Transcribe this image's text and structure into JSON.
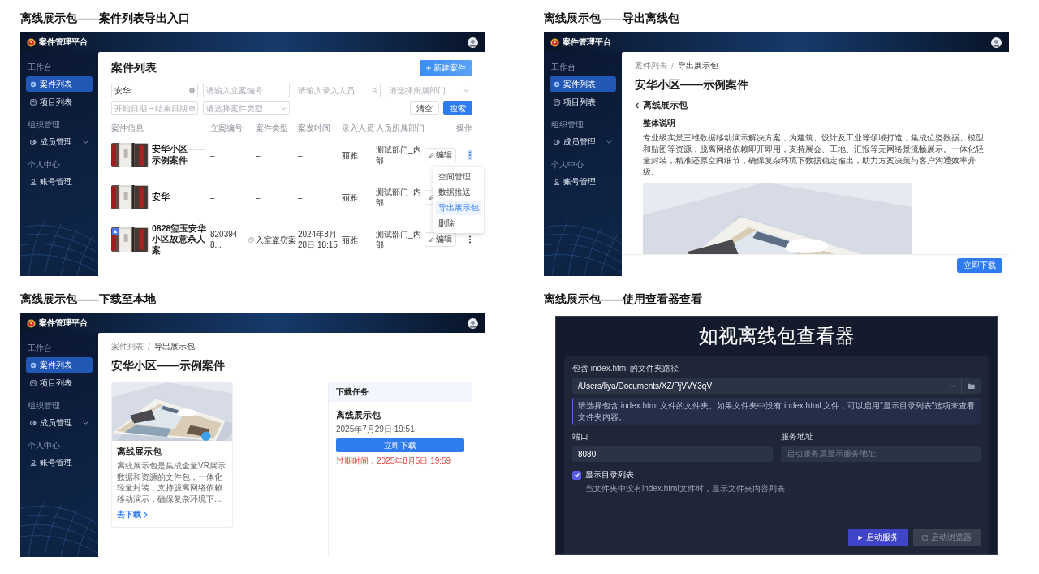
{
  "sections": [
    {
      "heading": "离线展示包——案件列表导出入口",
      "kind": "case_list",
      "app": {
        "brand": "案件管理平台",
        "nav": [
          {
            "group": "工作台",
            "items": [
              {
                "label": "案件列表",
                "selected": true
              },
              {
                "label": "项目列表",
                "selected": false
              }
            ]
          },
          {
            "group": "组织管理",
            "items": [
              {
                "label": "成员管理",
                "selected": false,
                "expanded": false
              }
            ]
          },
          {
            "group": "个人中心",
            "items": [
              {
                "label": "账号管理",
                "selected": false
              }
            ]
          }
        ]
      },
      "title": "案件列表",
      "new_button": "新建案件",
      "filters": [
        {
          "kind": "clearable",
          "value": "安华"
        },
        {
          "kind": "text",
          "placeholder": "请输入立案编号"
        },
        {
          "kind": "search",
          "placeholder": "请输入录入人员"
        },
        {
          "kind": "select",
          "placeholder": "请选择所属部门"
        },
        {
          "kind": "daterange",
          "start_placeholder": "开始日期",
          "end_placeholder": "结束日期"
        },
        {
          "kind": "select",
          "placeholder": "请选择案件类型"
        }
      ],
      "filter_buttons": [
        {
          "label": "清空",
          "kind": "secondary"
        },
        {
          "label": "搜索",
          "kind": "primary"
        }
      ],
      "columns": [
        "案件信息",
        "立案编号",
        "案件类型",
        "案发时间",
        "录入人员",
        "人员所属部门",
        "操作"
      ],
      "rows": [
        {
          "name": "安华小区——示例案件",
          "badge": false,
          "number": "–",
          "copyable": false,
          "type": "–",
          "time": "–",
          "person": "丽雅",
          "department": "测试部门_内部",
          "action": "编辑",
          "menu_open": true
        },
        {
          "name": "安华",
          "badge": false,
          "number": "–",
          "copyable": false,
          "type": "–",
          "time": "–",
          "person": "丽雅",
          "department": "测试部门_内部",
          "menu_open": false
        },
        {
          "name": "0828玺玉安华小区故意杀人案",
          "badge": true,
          "number": "8203948...",
          "copyable": true,
          "type": "入室盗窃案",
          "time": "2024年8月28日 18:15",
          "person": "丽雅",
          "department": "测试部门_内部",
          "action": "编辑",
          "menu_open": false
        }
      ],
      "menu": [
        {
          "label": "空间管理",
          "selected": false
        },
        {
          "label": "数据推送",
          "selected": false
        },
        {
          "label": "导出展示包",
          "selected": true
        },
        {
          "label": "删除",
          "selected": false
        }
      ]
    },
    {
      "heading": "离线展示包——导出离线包",
      "kind": "export",
      "app": {
        "brand": "案件管理平台",
        "nav": [
          {
            "group": "工作台",
            "items": [
              {
                "label": "案件列表",
                "selected": true
              },
              {
                "label": "项目列表",
                "selected": false
              }
            ]
          },
          {
            "group": "组织管理",
            "items": [
              {
                "label": "成员管理",
                "selected": false,
                "expanded": false
              }
            ]
          },
          {
            "group": "个人中心",
            "items": [
              {
                "label": "账号管理",
                "selected": false
              }
            ]
          }
        ]
      },
      "breadcrumb": [
        "案件列表",
        "导出展示包"
      ],
      "breadcrumb_separator": "/",
      "title": "安华小区——示例案件",
      "back": "离线展示包",
      "section_title": "整体说明",
      "description": "专业级实景三维数据移动演示解决方案，为建筑、设计及工业等领域打造，集成位姿数据、模型和贴图等资源，脱离网络依赖即开即用，支持展会、工地、汇报等无网络景流畅展示。一体化轻量封装，精准还原空间细节，确保复杂环境下数据稳定输出，助力方案决策与客户沟通效率升级。",
      "picture": {
        "kind": "picture"
      },
      "download_button": "立即下载"
    },
    {
      "heading": "离线展示包——下载至本地",
      "kind": "download",
      "app": {
        "brand": "案件管理平台",
        "nav": [
          {
            "group": "工作台",
            "items": [
              {
                "label": "案件列表",
                "selected": true
              },
              {
                "label": "项目列表",
                "selected": false
              }
            ]
          },
          {
            "group": "组织管理",
            "items": [
              {
                "label": "成员管理",
                "selected": false,
                "expanded": false
              }
            ]
          },
          {
            "group": "个人中心",
            "items": [
              {
                "label": "账号管理",
                "selected": false
              }
            ]
          }
        ]
      },
      "breadcrumb": [
        "案件列表",
        "导出展示包"
      ],
      "breadcrumb_separator": "/",
      "title": "安华小区——示例案件",
      "card": {
        "title": "离线展示包",
        "description": "离线展示包是集成全量VR展示数据和资源的文件包，一体化轻量封装，支持脱离网络依赖移动演示，确保复杂环境下...",
        "link": "去下载"
      },
      "tasks": {
        "title": "下载任务",
        "items": [
          {
            "name": "离线展示包",
            "date": "2025年7月29日 19:51",
            "button": "立即下载",
            "expiry": "过期时间：2025年8月5日 19:59"
          }
        ]
      }
    },
    {
      "heading": "离线展示包——使用查看器查看",
      "kind": "viewer",
      "title": "如视离线包查看器",
      "path_label": "包含 index.html 的文件夹路径",
      "path_value": "/Users/liya/Documents/XZ/PjVVY3qV",
      "hint": "请选择包含 index.html 文件的文件夹。如果文件夹中没有 index.html 文件，可以启用\"显示目录列表\"选项来查看文件夹内容。",
      "port_label": "端口",
      "port_value": "8080",
      "address_label": "服务地址",
      "address_placeholder": "启动服务后显示服务地址",
      "show_listing": {
        "label": "显示目录列表",
        "checked": true,
        "help": "当文件夹中没有index.html文件时，显示文件夹内容列表"
      },
      "buttons": [
        {
          "label": "启动服务",
          "kind": "start",
          "disabled": false
        },
        {
          "label": "启动浏览器",
          "kind": "browser",
          "disabled": true
        }
      ]
    }
  ]
}
